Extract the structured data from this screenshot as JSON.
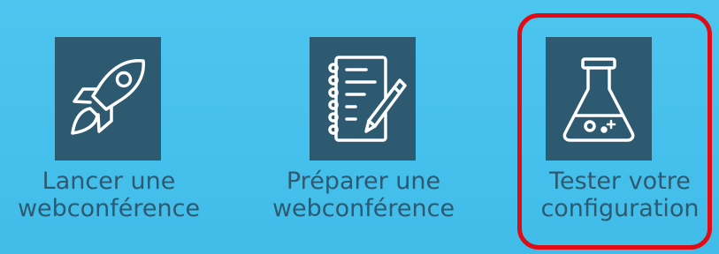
{
  "tiles": [
    {
      "id": "launch",
      "icon": "rocket-icon",
      "label_line1": "Lancer une",
      "label_line2": "webconférence"
    },
    {
      "id": "prepare",
      "icon": "notebook-pencil-icon",
      "label_line1": "Préparer une",
      "label_line2": "webconférence"
    },
    {
      "id": "test",
      "icon": "flask-icon",
      "label_line1": "Tester votre",
      "label_line2": "configuration"
    }
  ],
  "colors": {
    "background": "#46c0ec",
    "tile": "#2d5a70",
    "label": "#2d5a70",
    "highlight": "#e00b15"
  }
}
